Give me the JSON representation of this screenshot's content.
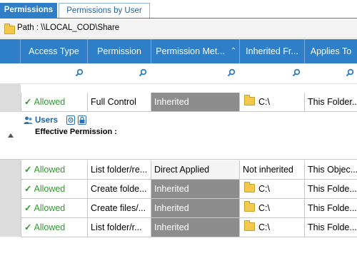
{
  "tabs": [
    {
      "label": "Permissions"
    },
    {
      "label": "Permissions by User"
    }
  ],
  "path": {
    "label": "Path : \\\\LOCAL_COD\\Share"
  },
  "columns": [
    "Access Type",
    "Permission",
    "Permission Met...",
    "Inherited Fr...",
    "Applies To"
  ],
  "rows_top": [
    {
      "access": "Allowed",
      "permission": "Full Control",
      "method": "Inherited",
      "inherited_from": "C:\\",
      "applies_to": "This Folder..."
    }
  ],
  "group": {
    "name": "Users",
    "effective_label": "Effective Permission :"
  },
  "rows_group": [
    {
      "access": "Allowed",
      "permission": "List folder/re...",
      "method": "Direct Applied",
      "inherited_from": "Not inherited",
      "applies_to": "This Objec..."
    },
    {
      "access": "Allowed",
      "permission": "Create folde...",
      "method": "Inherited",
      "inherited_from": "C:\\",
      "applies_to": "This Folde..."
    },
    {
      "access": "Allowed",
      "permission": "Create files/...",
      "method": "Inherited",
      "inherited_from": "C:\\",
      "applies_to": "This Folde..."
    },
    {
      "access": "Allowed",
      "permission": "List folder/r...",
      "method": "Inherited",
      "inherited_from": "C:\\",
      "applies_to": "This Folde..."
    }
  ],
  "colors": {
    "accent": "#2e7ec8",
    "allowed": "#2e9a2e",
    "inherited_cell": "#8d8d8d"
  }
}
